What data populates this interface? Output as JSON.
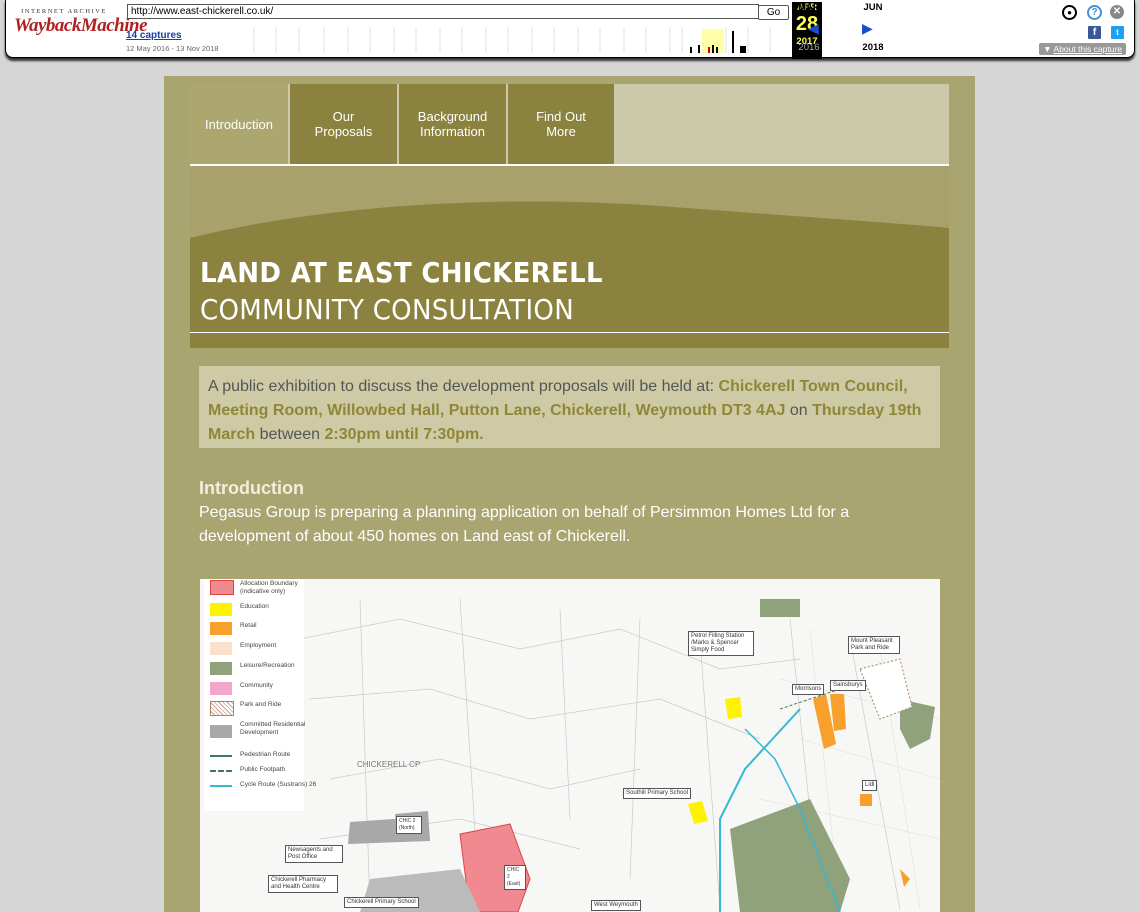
{
  "wayback": {
    "logo_top": "INTERNET ARCHIVE",
    "logo_main": "WaybackMachine",
    "url": "http://www.east-chickerell.co.uk/",
    "go_label": "Go",
    "captures_link": "14 captures",
    "capture_range": "12 May 2016 - 13 Nov 2018",
    "months": {
      "prev": "MAR",
      "current": "APR",
      "next": "JUN"
    },
    "day": "28",
    "years": {
      "prev": "2016",
      "current": "2017",
      "next": "2018"
    },
    "about_label": "About this capture"
  },
  "nav": {
    "tabs": [
      {
        "label": "Introduction"
      },
      {
        "label": "Our Proposals"
      },
      {
        "label": "Background Information"
      },
      {
        "label": "Find Out More"
      }
    ]
  },
  "banner": {
    "title": "LAND AT EAST CHICKERELL",
    "subtitle": "COMMUNITY CONSULTATION"
  },
  "notice": {
    "intro": "A public exhibition to discuss the development proposals will be held at: ",
    "venue": "Chickerell Town Council, Meeting Room, Willowbed Hall, Putton Lane, Chickerell, Weymouth DT3 4AJ",
    "on": " on ",
    "date": "Thursday 19th March",
    "between": " between ",
    "time": "2:30pm until 7:30pm."
  },
  "intro": {
    "heading": "Introduction",
    "body": "Pegasus Group is preparing a planning application on behalf of Persimmon Homes Ltd for a development of about 450 homes on Land east of Chickerell."
  },
  "map": {
    "legend": [
      {
        "label": "Allocation Boundary (indicative only)",
        "color": "#f08a90"
      },
      {
        "label": "Education",
        "color": "#fff200"
      },
      {
        "label": "Retail",
        "color": "#f7a12c"
      },
      {
        "label": "Employment",
        "color": "#fbe0cc"
      },
      {
        "label": "Leisure/Recreation",
        "color": "#8fa27c"
      },
      {
        "label": "Community",
        "color": "#f3a6c9"
      },
      {
        "label": "Park and Ride",
        "color": "#e8c6b4"
      },
      {
        "label": "Committed Residential Development",
        "color": "#a8a8a8"
      },
      {
        "label": "Pedestrian Route",
        "color": "#3f7a57"
      },
      {
        "label": "Public Footpath",
        "color": "#3f7a57"
      },
      {
        "label": "Cycle Route (Sustrans) 26",
        "color": "#33b8d8"
      }
    ],
    "labels": {
      "petrol": "Petrol Filling Station /Marks & Spencer Simply Food",
      "mountpleasant": "Mount Pleasant Park and Ride",
      "morrisons": "Morrisons",
      "sainsburys": "Sainsburys",
      "lidl": "Lidl",
      "southill": "Southill Primary School",
      "chickerell_cp": "CHICKERELL CP",
      "newsagents": "Newsagents and Post Office",
      "pharmacy": "Chickerell Pharmacy and Health Centre",
      "primary": "Chickerell Primary School",
      "westweymouth": "West Weymouth",
      "chic2north": "CHIC 2 (North)",
      "chic2east": "CHIC 2 (East)"
    }
  }
}
